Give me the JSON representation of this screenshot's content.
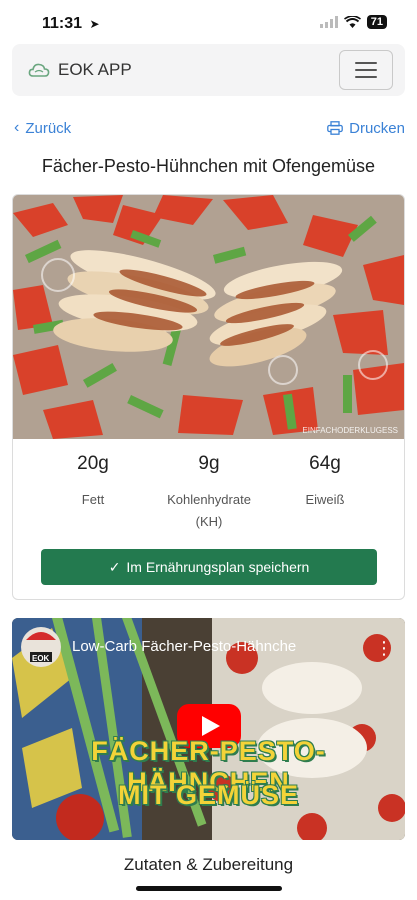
{
  "status": {
    "time": "11:31",
    "battery": "71"
  },
  "header": {
    "brand": "EOK APP"
  },
  "nav": {
    "back_label": "Zurück",
    "print_label": "Drucken"
  },
  "recipe": {
    "title": "Fächer-Pesto-Hühnchen mit Ofengemüse",
    "watermark": "EINFACHODERKLUGESS",
    "nutrition": [
      {
        "value": "20g",
        "label": "Fett"
      },
      {
        "value": "9g",
        "label": "Kohlenhydrate (KH)"
      },
      {
        "value": "64g",
        "label": "Eiweiß"
      }
    ],
    "save_label": "Im Ernährungsplan speichern"
  },
  "video": {
    "title": "Low-Carb Fächer-Pesto-Hähnche",
    "channel_avatar_text": "EOK",
    "overlay_line1": "FÄCHER-PESTO-HÄHNCHEN",
    "overlay_line2": "MIT GEMÜSE"
  },
  "section": {
    "heading": "Zutaten & Zubereitung"
  },
  "colors": {
    "accent_green": "#237a4f",
    "link_blue": "#3b82d6",
    "play_red": "#ff0000"
  }
}
